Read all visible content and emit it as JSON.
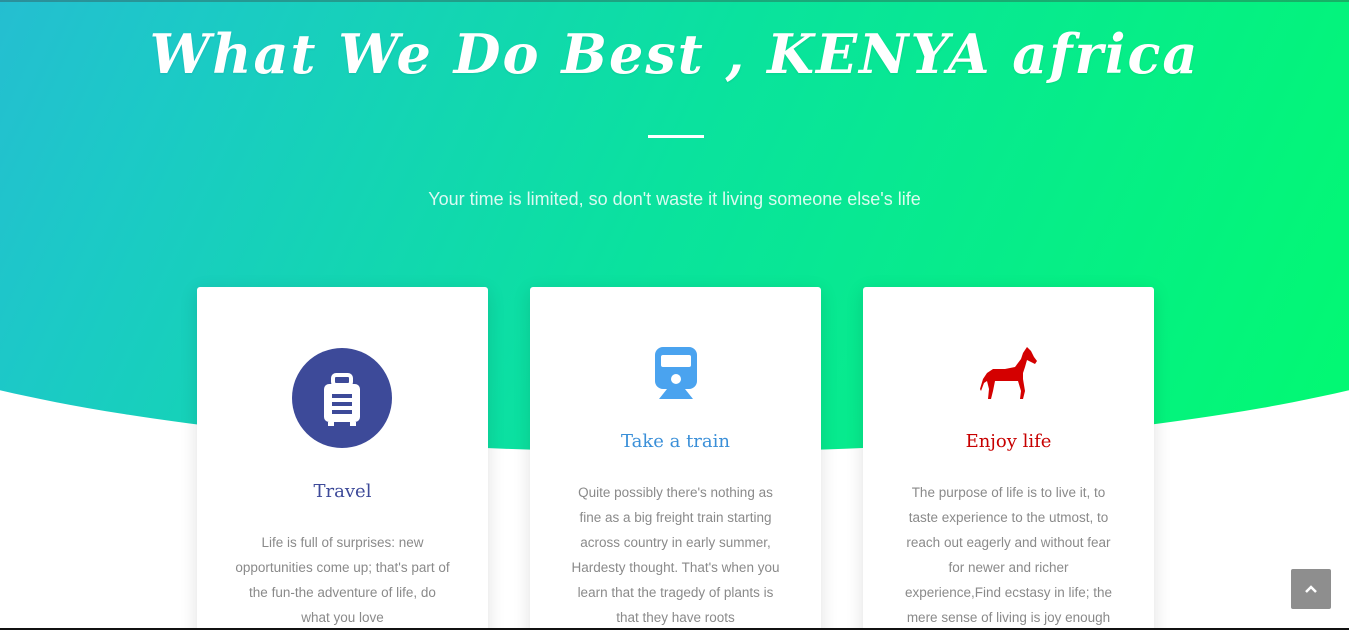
{
  "header": {
    "title": "What We Do Best , KENYA africa",
    "subtitle": "Your time is limited, so don't waste it living someone else's life"
  },
  "cards": [
    {
      "icon": "suitcase-icon",
      "title": "Travel",
      "text": "Life is full of surprises: new opportunities come up; that's part of the fun-the adventure of life, do what you love",
      "accent": "#3d4a99"
    },
    {
      "icon": "train-icon",
      "title": "Take a train",
      "text": "Quite possibly there's nothing as fine as a big freight train starting across country in early summer, Hardesty thought. That's when you learn that the tragedy of plants is that they have roots",
      "accent": "#3a8fd8"
    },
    {
      "icon": "horse-icon",
      "title": "Enjoy life",
      "text": "The purpose of life is to live it, to taste experience to the utmost, to reach out eagerly and without fear for newer and richer experience,Find ecstasy in life; the mere sense of living is joy enough",
      "accent": "#c70000"
    }
  ],
  "scroll_top": {
    "icon": "chevron-up-icon"
  },
  "colors": {
    "gradient_start": "#3aa3ea",
    "gradient_end": "#00ff66",
    "card_text": "#8a8a8a"
  }
}
